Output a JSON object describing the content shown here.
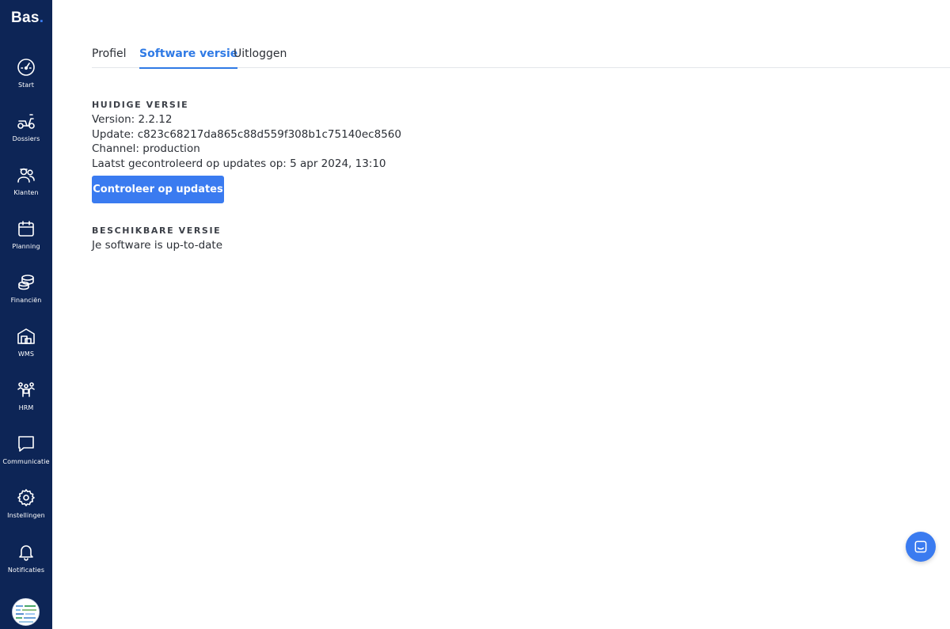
{
  "brand": {
    "logo_text": "Bas",
    "logo_dot": "."
  },
  "sidebar": {
    "items": [
      {
        "label": "Start",
        "icon": "dashboard-gauge-icon"
      },
      {
        "label": "Dossiers",
        "icon": "scooter-icon"
      },
      {
        "label": "Klanten",
        "icon": "customers-icon"
      },
      {
        "label": "Planning",
        "icon": "calendar-icon"
      },
      {
        "label": "Financiën",
        "icon": "coins-stack-icon"
      },
      {
        "label": "WMS",
        "icon": "warehouse-icon"
      },
      {
        "label": "HRM",
        "icon": "team-icon"
      },
      {
        "label": "Communicatie",
        "icon": "chat-bubble-icon"
      },
      {
        "label": "Instellingen",
        "icon": "gear-icon"
      },
      {
        "label": "Notificaties",
        "icon": "bell-icon"
      }
    ]
  },
  "tabs": [
    {
      "label": "Profiel",
      "active": false
    },
    {
      "label": "Software versie",
      "active": true
    },
    {
      "label": "Uitloggen",
      "active": false
    }
  ],
  "current": {
    "title": "HUIDIGE VERSIE",
    "version": "Version: 2.2.12",
    "update": "Update: c823c68217da865c88d559f308b1c75140ec8560",
    "channel": "Channel: production",
    "checked": "Laatst gecontroleerd op updates op: 5 apr 2024, 13:10",
    "button_label": "Controleer op updates"
  },
  "available": {
    "title": "BESCHIKBARE VERSIE",
    "status": "Je software is up-to-date"
  },
  "colors": {
    "sidebar_bg": "#0d2556",
    "accent": "#2f7ae5",
    "button_bg": "#3a7bf0"
  }
}
